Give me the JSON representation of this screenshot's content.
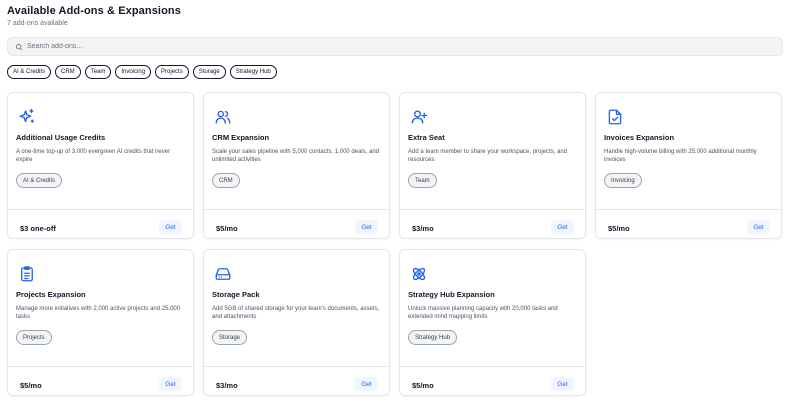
{
  "header": {
    "title": "Available Add-ons & Expansions",
    "subtitle": "7 add-ons available"
  },
  "search": {
    "placeholder": "Search add-ons...",
    "icon": "search-icon"
  },
  "filters": [
    "AI & Credits",
    "CRM",
    "Team",
    "Invoicing",
    "Projects",
    "Storage",
    "Strategy Hub"
  ],
  "colors": {
    "accent": "#2563eb",
    "accent_bg": "#eff6ff",
    "border": "#e5e7eb",
    "text": "#111827",
    "muted": "#4b5563"
  },
  "addons": [
    {
      "name": "Additional Usage Credits",
      "icon": "sparkles-icon",
      "description": "A one-time top-up of 3,000 evergreen AI credits that never expire",
      "tag": "AI & Credits",
      "price": "$3 one-off",
      "button": "Get"
    },
    {
      "name": "CRM Expansion",
      "icon": "users-icon",
      "description": "Scale your sales pipeline with 5,000 contacts, 1,000 deals, and unlimited activities",
      "tag": "CRM",
      "price": "$5/mo",
      "button": "Get"
    },
    {
      "name": "Extra Seat",
      "icon": "user-plus-icon",
      "description": "Add a team member to share your workspace, projects, and resources",
      "tag": "Team",
      "price": "$3/mo",
      "button": "Get"
    },
    {
      "name": "Invoices Expansion",
      "icon": "file-check-icon",
      "description": "Handle high-volume billing with 25,000 additional monthly invoices",
      "tag": "Invoicing",
      "price": "$5/mo",
      "button": "Get"
    },
    {
      "name": "Projects Expansion",
      "icon": "clipboard-list-icon",
      "description": "Manage more initiatives with 2,000 active projects and 25,000 tasks",
      "tag": "Projects",
      "price": "$5/mo",
      "button": "Get"
    },
    {
      "name": "Storage Pack",
      "icon": "hard-drive-icon",
      "description": "Add 5GB of shared storage for your team's documents, assets, and attachments",
      "tag": "Storage",
      "price": "$3/mo",
      "button": "Get"
    },
    {
      "name": "Strategy Hub Expansion",
      "icon": "atom-icon",
      "description": "Unlock massive planning capacity with 20,000 tasks and extended mind mapping limits",
      "tag": "Strategy Hub",
      "price": "$5/mo",
      "button": "Get"
    }
  ]
}
